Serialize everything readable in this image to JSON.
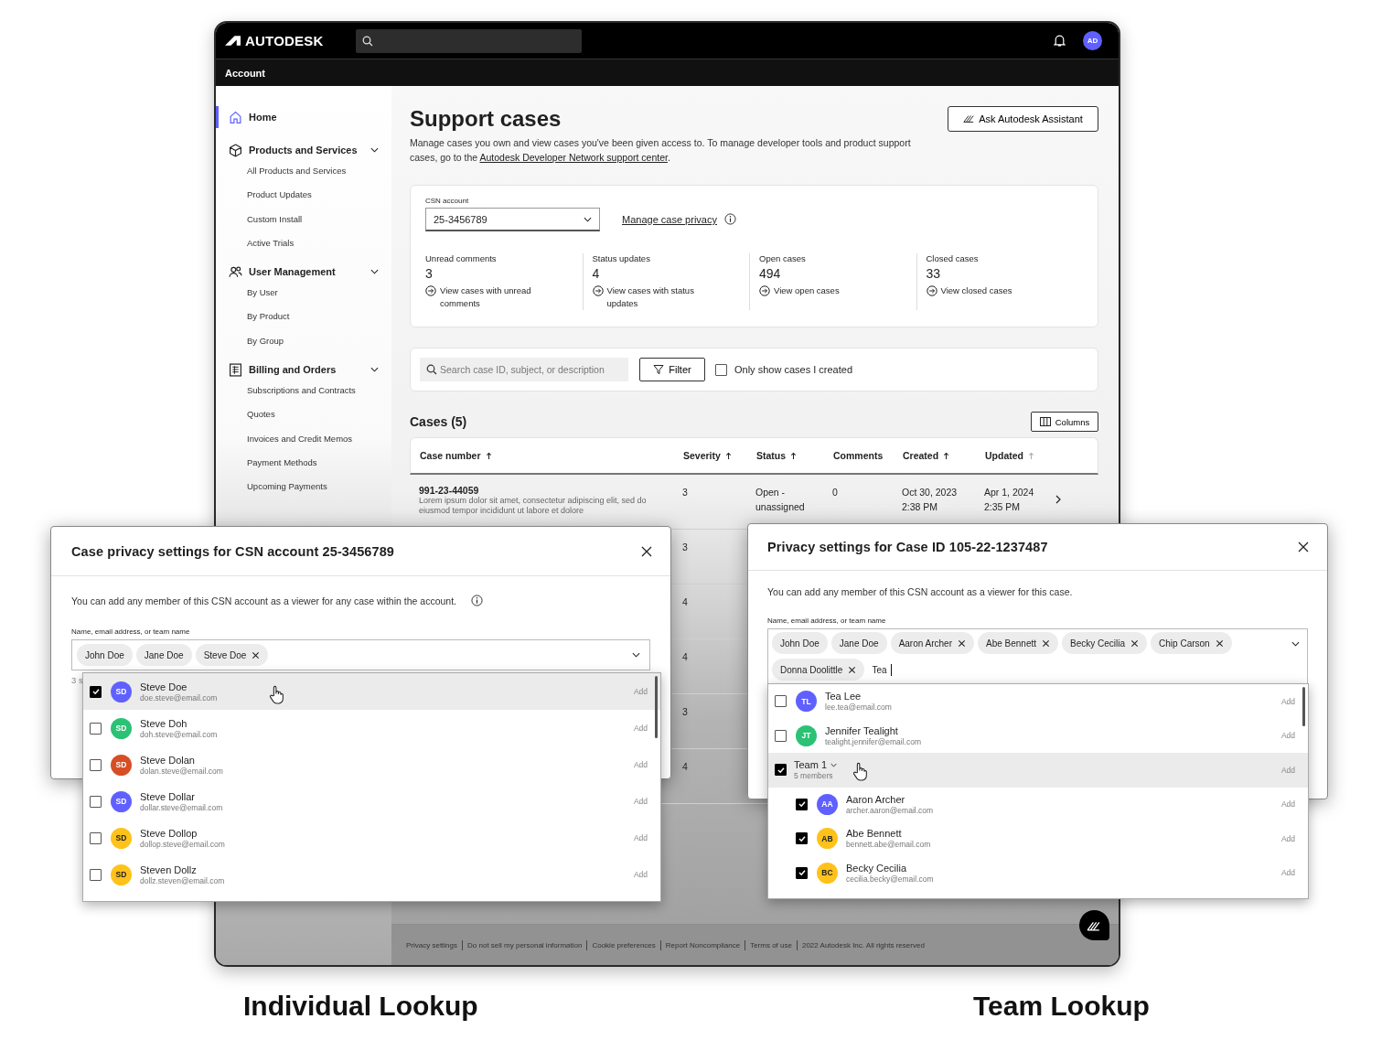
{
  "app_header": {
    "logo": "AUTODESK",
    "avatar": "AD",
    "section": "Account"
  },
  "sidebar": [
    {
      "label": "Home",
      "selected": true
    },
    {
      "label": "Products and Services",
      "selected": false,
      "expanded": true,
      "children": [
        "All Products and Services",
        "Product Updates",
        "Custom Install",
        "Active Trials"
      ]
    },
    {
      "label": "User Management",
      "selected": false,
      "expanded": true,
      "children": [
        "By User",
        "By Product",
        "By Group"
      ]
    },
    {
      "label": "Billing and Orders",
      "selected": false,
      "expanded": true,
      "children": [
        "Subscriptions and Contracts",
        "Quotes",
        "Invoices and Credit Memos",
        "Payment Methods",
        "Upcoming Payments"
      ]
    }
  ],
  "page": {
    "title": "Support cases",
    "assistant_button": "Ask Autodesk Assistant",
    "description": "Manage cases you own and view cases you've been given access to.  To manage developer tools and product support cases, go to the ",
    "description_link": "Autodesk Developer Network support center",
    "description_end": "."
  },
  "csn": {
    "label": "CSN account",
    "value": "25-3456789",
    "privacy_link": "Manage case privacy",
    "stats": [
      {
        "label": "Unread comments",
        "value": "3",
        "link": "View cases with unread comments"
      },
      {
        "label": "Status updates",
        "value": "4",
        "link": "View cases with status updates"
      },
      {
        "label": "Open cases",
        "value": "494",
        "link": "View open cases"
      },
      {
        "label": "Closed cases",
        "value": "33",
        "link": "View closed cases"
      }
    ]
  },
  "filters": {
    "search_placeholder": "Search case ID, subject, or description",
    "filter_button": "Filter",
    "only_mine": {
      "label": "Only show cases I created",
      "checked": false
    }
  },
  "cases": {
    "title": "Cases (5)",
    "columns_button": "Columns",
    "columns": [
      {
        "label": "Case number",
        "sorted": true
      },
      {
        "label": "Severity",
        "sorted": true
      },
      {
        "label": "Status",
        "sorted": true
      },
      {
        "label": "Comments"
      },
      {
        "label": "Created",
        "sorted": true
      },
      {
        "label": "Updated",
        "sorted": false
      }
    ],
    "rows": [
      {
        "case_number": "991-23-44059",
        "description": "Lorem ipsum dolor sit amet, consectetur adipiscing elit, sed do eiusmod tempor incididunt ut labore et dolore",
        "severity": "3",
        "status": "Open - unassigned",
        "comments": "0",
        "created": "Oct 30, 2023 2:38 PM",
        "updated": "Apr 1, 2024 2:35 PM"
      },
      {
        "severity": "3"
      },
      {
        "severity": "4"
      },
      {
        "severity": "4"
      },
      {
        "severity": "3"
      },
      {
        "severity": "4"
      }
    ]
  },
  "footer": {
    "links": [
      "Privacy settings",
      "Do not sell my personal information",
      "Cookie preferences",
      "Report Noncompliance",
      "Terms of use",
      "2022 Autodesk Inc. All rights reserved"
    ]
  },
  "left_dialog": {
    "title": "Case privacy settings for CSN account 25-3456789",
    "description": "You can add any member of this CSN account as a viewer for any case within the account.",
    "field_label": "Name, email address, or team name",
    "chips": [
      {
        "label": "John Doe",
        "removable": false
      },
      {
        "label": "Jane Doe",
        "removable": false
      },
      {
        "label": "Steve Doe",
        "removable": true
      }
    ],
    "helper": "3 s",
    "options": [
      {
        "initials": "SD",
        "color": "#5f60ff",
        "name": "Steve Doe",
        "email": "doe.steve@email.com",
        "checked": true,
        "selected": true,
        "action": "Add"
      },
      {
        "initials": "SD",
        "color": "#2bc275",
        "name": "Steve Doh",
        "email": "doh.steve@email.com",
        "checked": false,
        "selected": false,
        "action": "Add"
      },
      {
        "initials": "SD",
        "color": "#d74e26",
        "name": "Steve Dolan",
        "email": "dolan.steve@email.com",
        "checked": false,
        "selected": false,
        "action": "Add"
      },
      {
        "initials": "SD",
        "color": "#5f60ff",
        "name": "Steve Dollar",
        "email": "dollar.steve@email.com",
        "checked": false,
        "selected": false,
        "action": "Add"
      },
      {
        "initials": "SD",
        "color": "#ffc21a",
        "name": "Steve Dollop",
        "email": "dollop.steve@email.com",
        "checked": false,
        "selected": false,
        "action": "Add"
      },
      {
        "initials": "SD",
        "color": "#ffc21a",
        "name": "Steven Dollz",
        "email": "dollz.steven@email.com",
        "checked": false,
        "selected": false,
        "action": "Add"
      }
    ]
  },
  "right_dialog": {
    "title": "Privacy settings for Case ID 105-22-1237487",
    "description": "You can add any member of this CSN account as a viewer for this case.",
    "field_label": "Name, email address, or team name",
    "chips": [
      {
        "label": "John Doe",
        "removable": false
      },
      {
        "label": "Jane Doe",
        "removable": false
      },
      {
        "label": "Aaron Archer",
        "removable": true
      },
      {
        "label": "Abe Bennett",
        "removable": true
      },
      {
        "label": "Becky Cecilia",
        "removable": true
      },
      {
        "label": "Chip Carson",
        "removable": true
      },
      {
        "label": "Donna Doolittle",
        "removable": true
      }
    ],
    "input_value": "Tea",
    "options": [
      {
        "kind": "person",
        "initials": "TL",
        "color": "#5f60ff",
        "name": "Tea Lee",
        "email": "lee.tea@email.com",
        "checked": false,
        "selected": false,
        "action": "Add"
      },
      {
        "kind": "person",
        "initials": "JT",
        "color": "#2bc275",
        "name": "Jennifer Tealight",
        "email": "tealight.jennifer@email.com",
        "checked": false,
        "selected": false,
        "action": "Add"
      },
      {
        "kind": "team",
        "name": "Team 1",
        "members": "5 members",
        "checked": true,
        "selected": true,
        "expanded": true,
        "action": "Add",
        "children": [
          {
            "kind": "person",
            "initials": "AA",
            "color": "#5f60ff",
            "name": "Aaron Archer",
            "email": "archer.aaron@email.com",
            "checked": true,
            "selected": false,
            "action": "Add"
          },
          {
            "kind": "person",
            "initials": "AB",
            "color": "#ffc21a",
            "name": "Abe Bennett",
            "email": "bennett.abe@email.com",
            "checked": true,
            "selected": false,
            "action": "Add"
          },
          {
            "kind": "person",
            "initials": "BC",
            "color": "#ffc21a",
            "name": "Becky Cecilia",
            "email": "cecilia.becky@email.com",
            "checked": true,
            "selected": false,
            "action": "Add"
          }
        ]
      }
    ]
  },
  "captions": [
    "Individual Lookup",
    "Team Lookup"
  ]
}
